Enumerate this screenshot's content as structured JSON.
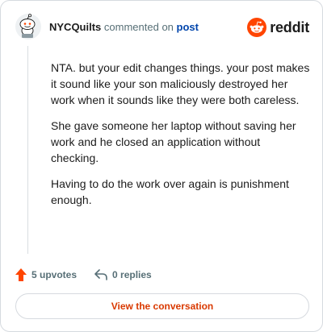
{
  "header": {
    "username": "NYCQuilts",
    "commented_on": "commented on",
    "post_link": "post",
    "brand": "reddit"
  },
  "comment": {
    "paragraphs": [
      "NTA. but your edit changes things. your post makes it sound like your son maliciously destroyed her work when it sounds like they were both careless.",
      "She gave someone her laptop without saving her work and he closed an application without checking.",
      "Having to do the work over again is punishment enough."
    ]
  },
  "actions": {
    "upvotes": "5 upvotes",
    "replies": "0 replies"
  },
  "cta": {
    "label": "View the conversation"
  },
  "colors": {
    "accent": "#ff4500",
    "link": "#0045ac",
    "cta_text": "#d93900",
    "muted": "#576f76"
  },
  "icons": {
    "avatar": "snoo-avatar-icon",
    "brand": "reddit-logo-icon",
    "upvote": "upvote-arrow-icon",
    "reply": "reply-arrow-icon"
  }
}
